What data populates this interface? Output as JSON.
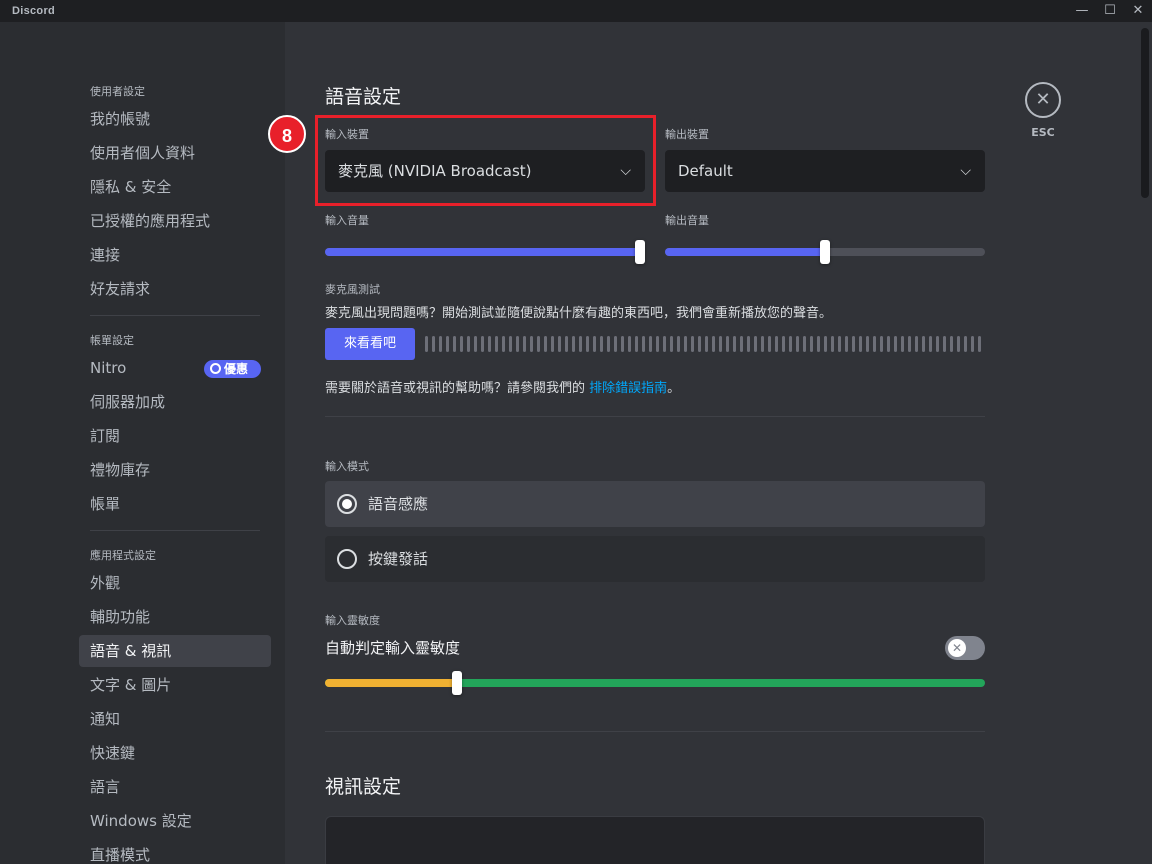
{
  "app": {
    "title": "Discord"
  },
  "sidebar": {
    "section_user": "使用者設定",
    "user_items": [
      "我的帳號",
      "使用者個人資料",
      "隱私 & 安全",
      "已授權的應用程式",
      "連接",
      "好友請求"
    ],
    "section_billing": "帳單設定",
    "billing_items": [
      "Nitro",
      "伺服器加成",
      "訂閱",
      "禮物庫存",
      "帳單"
    ],
    "nitro_badge": "優惠",
    "section_app": "應用程式設定",
    "app_items": [
      "外觀",
      "輔助功能",
      "語音 & 視訊",
      "文字 & 圖片",
      "通知",
      "快速鍵",
      "語言",
      "Windows 設定",
      "直播模式"
    ],
    "active_item": "語音 & 視訊"
  },
  "voice": {
    "title": "語音設定",
    "input_device_label": "輸入裝置",
    "input_device_value": "麥克風 (NVIDIA Broadcast)",
    "output_device_label": "輸出裝置",
    "output_device_value": "Default",
    "input_volume_label": "輸入音量",
    "input_volume": 1.0,
    "output_volume_label": "輸出音量",
    "output_volume": 0.5,
    "mic_test_label": "麥克風測試",
    "mic_test_desc": "麥克風出現問題嗎？開始測試並隨便說點什麼有趣的東西吧，我們會重新播放您的聲音。",
    "mic_test_button": "來看看吧",
    "help_text": "需要關於語音或視訊的幫助嗎？請參閱我們的 ",
    "help_link": "排除錯誤指南",
    "help_suffix": "。",
    "input_mode_label": "輸入模式",
    "mode_voice_activity": "語音感應",
    "mode_push_to_talk": "按鍵發話",
    "selected_mode": "語音感應",
    "sensitivity_label": "輸入靈敏度",
    "auto_sensitivity_label": "自動判定輸入靈敏度",
    "auto_sensitivity_enabled": false,
    "sensitivity_threshold": 0.2
  },
  "video": {
    "title": "視訊設定"
  },
  "esc_label": "ESC",
  "annotation_step": "8",
  "colors": {
    "accent": "#5865f2",
    "highlight": "#e8202a",
    "link": "#00a8fc",
    "sensitivity_low": "#f0b132",
    "sensitivity_high": "#23a55a"
  }
}
